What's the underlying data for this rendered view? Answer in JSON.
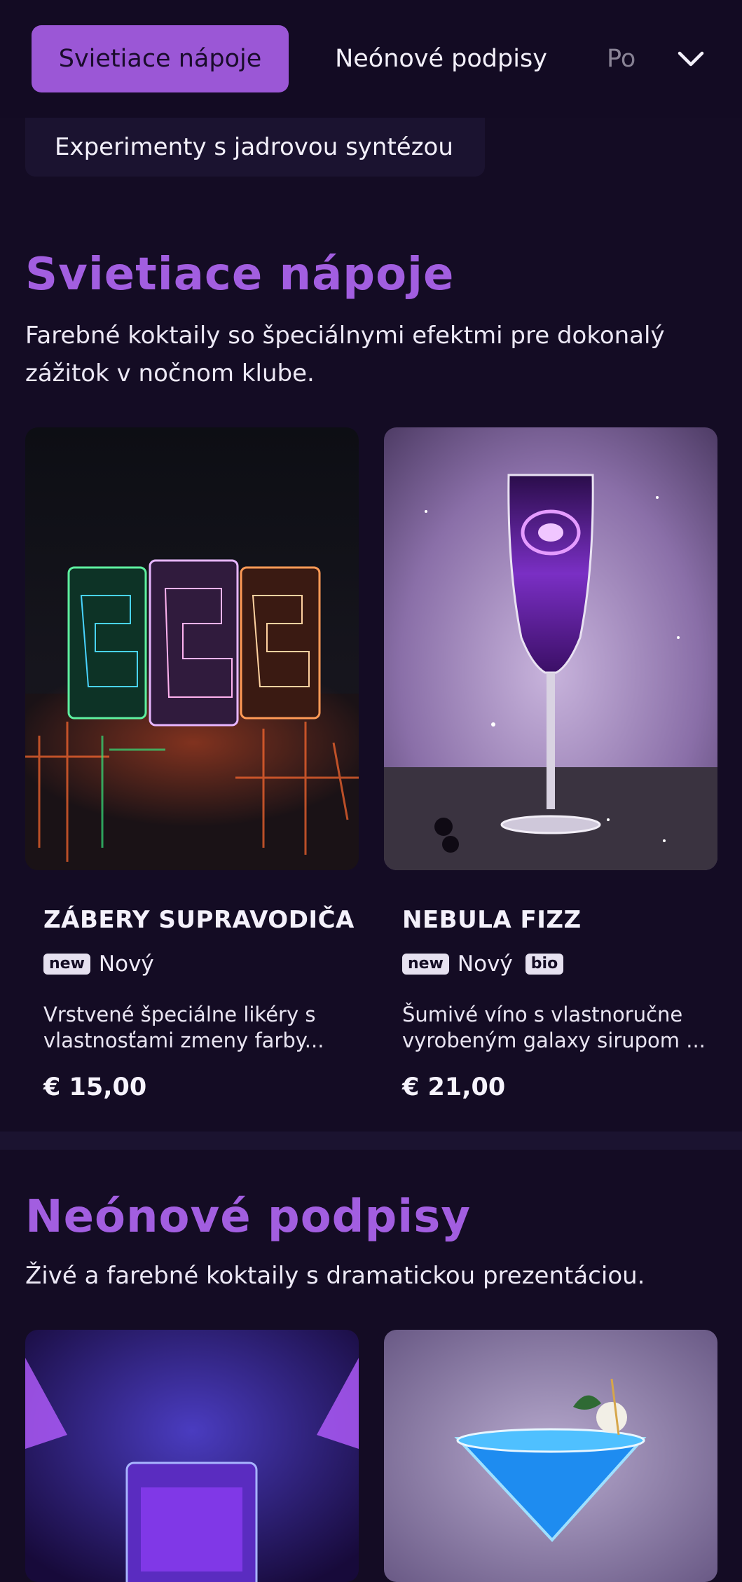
{
  "tabs": [
    {
      "label": "Svietiace nápoje",
      "active": true
    },
    {
      "label": "Neónové podpisy",
      "active": false
    },
    {
      "label": "Po",
      "active": false
    }
  ],
  "extra_tab": {
    "label": "Experimenty s jadrovou syntézou"
  },
  "menu_toggle_icon": "chevron-down-icon",
  "sections": [
    {
      "title": "Svietiace nápoje",
      "description": "Farebné koktaily so špeciálnymi efektmi pre dokonalý zážitok v nočnom klube.",
      "items": [
        {
          "name": "ZÁBERY SUPRAVODIČA",
          "badge": "new",
          "badge_label": "Nový",
          "description_line1": "Vrstvené špeciálne likéry s",
          "description_line2": "vlastnosťami zmeny farby...",
          "price": "€ 15,00"
        },
        {
          "name": "NEBULA FIZZ",
          "badge": "new",
          "badge_label": "Nový",
          "badge2": "bio",
          "description_line1": "Šumivé víno s vlastnoručne",
          "description_line2": "vyrobeným galaxy sirupom ...",
          "price": "€ 21,00"
        }
      ]
    },
    {
      "title": "Neónové podpisy",
      "description": "Živé a farebné koktaily s dramatickou prezentáciou."
    }
  ],
  "colors": {
    "background": "#140c24",
    "accent": "#9b57d6",
    "title": "#a25ee0"
  }
}
